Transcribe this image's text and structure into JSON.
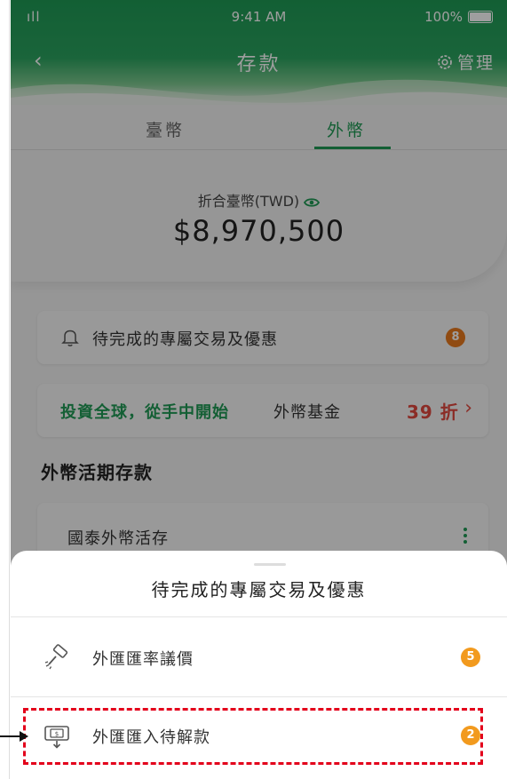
{
  "status_bar": {
    "signal": "ıll",
    "time": "9:41 AM",
    "battery": "100%"
  },
  "nav": {
    "back": "‹",
    "title": "存款",
    "manage": "管理"
  },
  "tabs": [
    {
      "label": "臺幣"
    },
    {
      "label": "外幣",
      "active": true
    }
  ],
  "balance": {
    "label": "折合臺幣(TWD)",
    "amount": "$8,970,500"
  },
  "pending": {
    "label": "待完成的專屬交易及優惠",
    "count": "8"
  },
  "promo": {
    "green_text": "投資全球，從手中開始",
    "mid_text": "外幣基金",
    "red_text": "39 折",
    "arrow": "›"
  },
  "section": {
    "title": "外幣活期存款"
  },
  "account": {
    "label": "國泰外幣活存"
  },
  "sheet": {
    "title": "待完成的專屬交易及優惠",
    "items": [
      {
        "label": "外匯匯率議價",
        "count": "5",
        "icon": "gavel-icon"
      },
      {
        "label": "外匯匯入待解款",
        "count": "2",
        "icon": "money-inbound-icon"
      }
    ]
  },
  "colors": {
    "brand_green": "#1f9a55",
    "badge_orange": "#e87a1d",
    "promo_red": "#e0473e",
    "highlight_red": "#e3001b"
  }
}
